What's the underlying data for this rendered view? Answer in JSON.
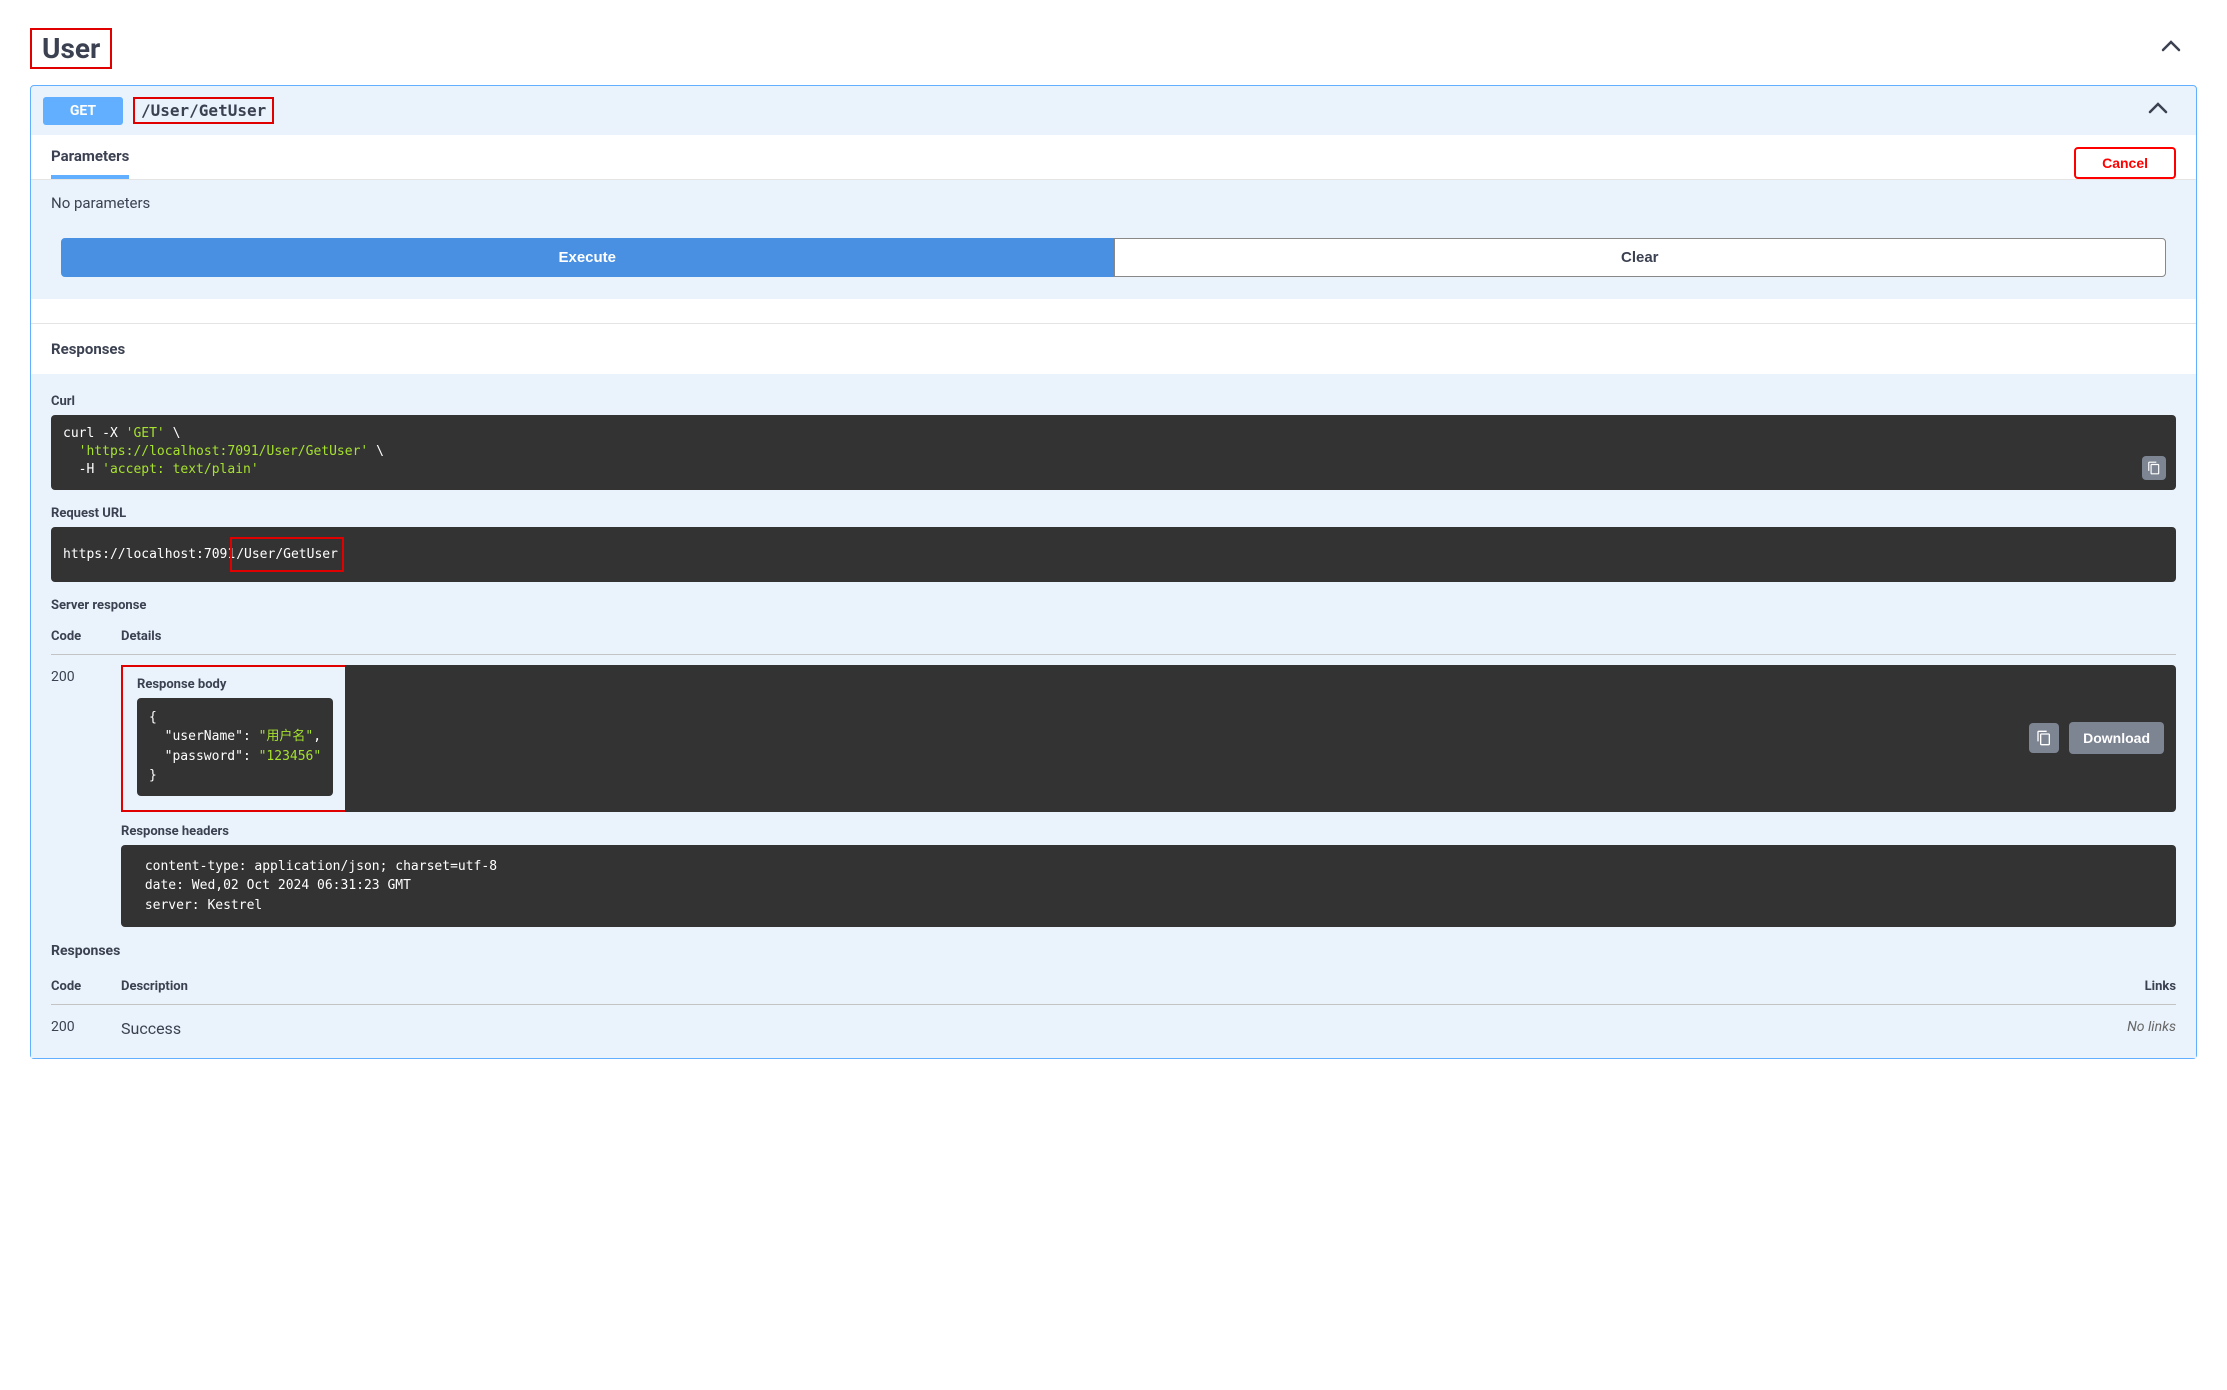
{
  "section": {
    "title": "User"
  },
  "endpoint": {
    "method": "GET",
    "path": "/User/GetUser"
  },
  "parameters": {
    "tab_label": "Parameters",
    "cancel_label": "Cancel",
    "empty_text": "No parameters",
    "execute_label": "Execute",
    "clear_label": "Clear"
  },
  "responses": {
    "header": "Responses",
    "curl_label": "Curl",
    "curl_prefix": "curl -X ",
    "curl_method": "'GET'",
    "curl_slash": " \\",
    "curl_url": "'https://localhost:7091/User/GetUser'",
    "curl_hflag": "  -H ",
    "curl_header": "'accept: text/plain'",
    "request_url_label": "Request URL",
    "request_url_prefix": "https://localhost:7091",
    "request_url_suffix": "/User/GetUser",
    "server_response_label": "Server response",
    "code_header": "Code",
    "details_header": "Details",
    "status_code": "200",
    "response_body_label": "Response body",
    "response_body_json": {
      "open": "{",
      "line1_key": "\"userName\"",
      "line1_val": "\"用户名\"",
      "line2_key": "\"password\"",
      "line2_val": "\"123456\"",
      "close": "}"
    },
    "download_label": "Download",
    "response_headers_label": "Response headers",
    "response_headers_text": " content-type: application/json; charset=utf-8 \n date: Wed,02 Oct 2024 06:31:23 GMT \n server: Kestrel ",
    "documented_responses_label": "Responses",
    "doc_code_header": "Code",
    "doc_description_header": "Description",
    "doc_links_header": "Links",
    "doc_code": "200",
    "doc_description": "Success",
    "doc_links": "No links"
  }
}
